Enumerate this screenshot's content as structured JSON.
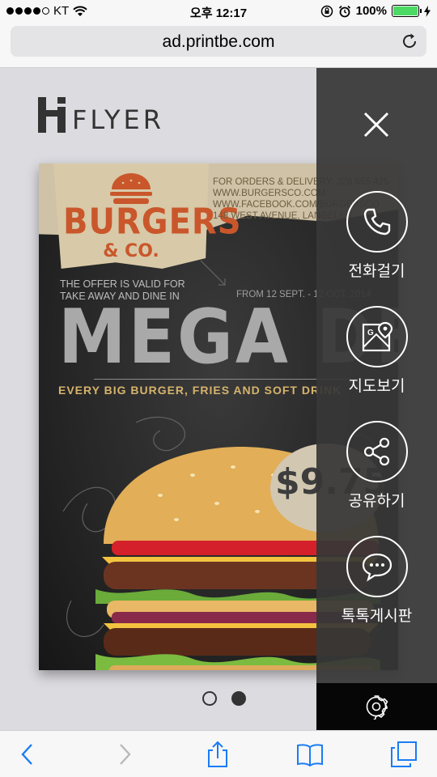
{
  "status_bar": {
    "carrier": "KT",
    "time": "오후 12:17",
    "battery": "100%",
    "battery_level": 1.0
  },
  "browser": {
    "url": "ad.printbe.com"
  },
  "logo": {
    "text": "FLYER"
  },
  "flyer": {
    "brand": "BURGERS",
    "brand_sub": "& CO.",
    "contact_lines": [
      "FOR ORDERS & DELIVERY: 326 555 425",
      "WWW.BURGERSCO.COM",
      "WWW.FACEBOOK.COM/BURGERSCO",
      "148 WEST AVENUE, LANGELES"
    ],
    "offer_line1": "THE OFFER IS VALID FOR",
    "offer_line2": "TAKE AWAY AND DINE IN",
    "dates": "FROM 12 SEPT. - 12 OCT. 2014",
    "headline": "MEGA DEAL",
    "tagline": "EVERY BIG BURGER, FRIES AND SOFT DRINK",
    "price": "$9.75"
  },
  "side_panel": {
    "actions": [
      {
        "label": "전화걸기",
        "icon": "phone-icon"
      },
      {
        "label": "지도보기",
        "icon": "map-icon"
      },
      {
        "label": "공유하기",
        "icon": "share-icon"
      },
      {
        "label": "톡톡게시판",
        "icon": "chat-icon"
      }
    ]
  },
  "pager": {
    "pages": 2,
    "active": 2
  },
  "colors": {
    "panel": "#373737",
    "brand": "#c9572b",
    "battery": "#4cd964",
    "ios_blue": "#1a7cf5"
  }
}
